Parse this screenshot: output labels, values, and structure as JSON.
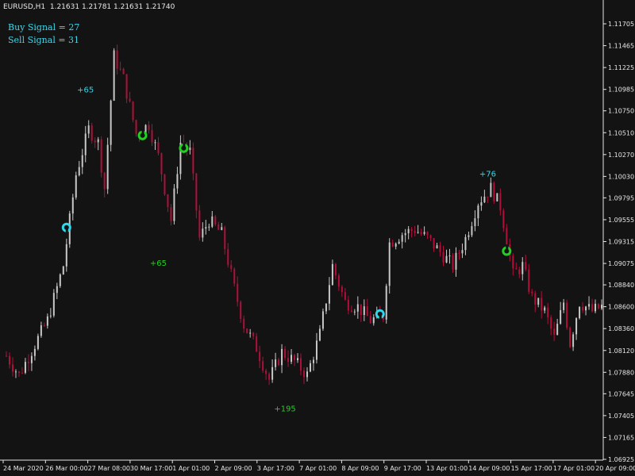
{
  "header": {
    "symbol": "EURUSD,H1",
    "quote": "1.21631 1.21781 1.21631 1.21740"
  },
  "signals": {
    "buy": "Buy Signal = 27",
    "sell": "Sell Signal = 31"
  },
  "colors": {
    "background": "#131313",
    "bull_candle": "#c8c8c8",
    "bear_candle": "#b0103a",
    "axis": "#e6e6e6",
    "cyan": "#2fd8ea",
    "green": "#22d022"
  },
  "chart_data": {
    "type": "candlestick",
    "grid": false,
    "y_ticks": [
      "1.11705",
      "1.11465",
      "1.11225",
      "1.10985",
      "1.10750",
      "1.10510",
      "1.10270",
      "1.10030",
      "1.09795",
      "1.09555",
      "1.09315",
      "1.09075",
      "1.08840",
      "1.08600",
      "1.08360",
      "1.08120",
      "1.07880",
      "1.07645",
      "1.07405",
      "1.07165",
      "1.06925"
    ],
    "ylim": [
      1.06925,
      1.11705
    ],
    "x_ticks": [
      "24 Mar 2020",
      "26 Mar 00:00",
      "27 Mar 08:00",
      "30 Mar 17:00",
      "1 Apr 01:00",
      "2 Apr 09:00",
      "3 Apr 17:00",
      "7 Apr 01:00",
      "8 Apr 09:00",
      "9 Apr 17:00",
      "13 Apr 01:00",
      "14 Apr 09:00",
      "15 Apr 17:00",
      "17 Apr 01:00",
      "20 Apr 09:00"
    ],
    "close_path": [
      {
        "t": 0,
        "price": 1.0806
      },
      {
        "t": 4,
        "price": 1.0785
      },
      {
        "t": 8,
        "price": 1.0812
      },
      {
        "t": 13,
        "price": 1.0845
      },
      {
        "t": 18,
        "price": 1.0905
      },
      {
        "t": 22,
        "price": 1.1005
      },
      {
        "t": 26,
        "price": 1.1055
      },
      {
        "t": 29,
        "price": 1.104
      },
      {
        "t": 31,
        "price": 1.099
      },
      {
        "t": 34,
        "price": 1.1135
      },
      {
        "t": 37,
        "price": 1.111
      },
      {
        "t": 41,
        "price": 1.105
      },
      {
        "t": 45,
        "price": 1.106
      },
      {
        "t": 48,
        "price": 1.1025
      },
      {
        "t": 52,
        "price": 1.0955
      },
      {
        "t": 55,
        "price": 1.104
      },
      {
        "t": 58,
        "price": 1.103
      },
      {
        "t": 61,
        "price": 1.0935
      },
      {
        "t": 64,
        "price": 1.0955
      },
      {
        "t": 68,
        "price": 1.094
      },
      {
        "t": 72,
        "price": 1.088
      },
      {
        "t": 75,
        "price": 1.084
      },
      {
        "t": 79,
        "price": 1.0815
      },
      {
        "t": 83,
        "price": 1.078
      },
      {
        "t": 87,
        "price": 1.081
      },
      {
        "t": 91,
        "price": 1.08
      },
      {
        "t": 95,
        "price": 1.0785
      },
      {
        "t": 99,
        "price": 1.083
      },
      {
        "t": 103,
        "price": 1.0905
      },
      {
        "t": 107,
        "price": 1.0865
      },
      {
        "t": 111,
        "price": 1.086
      },
      {
        "t": 115,
        "price": 1.0845
      },
      {
        "t": 119,
        "price": 1.085
      },
      {
        "t": 121,
        "price": 1.093
      },
      {
        "t": 125,
        "price": 1.094
      },
      {
        "t": 129,
        "price": 1.0945
      },
      {
        "t": 133,
        "price": 1.0935
      },
      {
        "t": 137,
        "price": 1.092
      },
      {
        "t": 141,
        "price": 1.0905
      },
      {
        "t": 145,
        "price": 1.0935
      },
      {
        "t": 149,
        "price": 1.0975
      },
      {
        "t": 153,
        "price": 1.099
      },
      {
        "t": 156,
        "price": 1.097
      },
      {
        "t": 158,
        "price": 1.0935
      },
      {
        "t": 160,
        "price": 1.0895
      },
      {
        "t": 163,
        "price": 1.0905
      },
      {
        "t": 166,
        "price": 1.087
      },
      {
        "t": 170,
        "price": 1.0855
      },
      {
        "t": 173,
        "price": 1.0825
      },
      {
        "t": 176,
        "price": 1.0865
      },
      {
        "t": 178,
        "price": 1.082
      },
      {
        "t": 181,
        "price": 1.0865
      },
      {
        "t": 185,
        "price": 1.0855
      },
      {
        "t": 188,
        "price": 1.086
      }
    ],
    "annotations": [
      {
        "text": "+65",
        "t": 25,
        "price": 1.1095,
        "color": "cyan"
      },
      {
        "text": "+65",
        "t": 48,
        "price": 1.0905,
        "color": "green"
      },
      {
        "text": "+195",
        "t": 88,
        "price": 1.0745,
        "color": "green"
      },
      {
        "text": "+76",
        "t": 152,
        "price": 1.1003,
        "color": "cyan"
      }
    ],
    "markers": [
      {
        "kind": "buy",
        "t": 19,
        "price": 1.0947,
        "color": "cyan"
      },
      {
        "kind": "sell",
        "t": 43,
        "price": 1.1048,
        "color": "green"
      },
      {
        "kind": "sell",
        "t": 56,
        "price": 1.1034,
        "color": "green"
      },
      {
        "kind": "buy",
        "t": 118,
        "price": 1.0852,
        "color": "cyan"
      },
      {
        "kind": "sell",
        "t": 158,
        "price": 1.0921,
        "color": "green"
      }
    ]
  }
}
